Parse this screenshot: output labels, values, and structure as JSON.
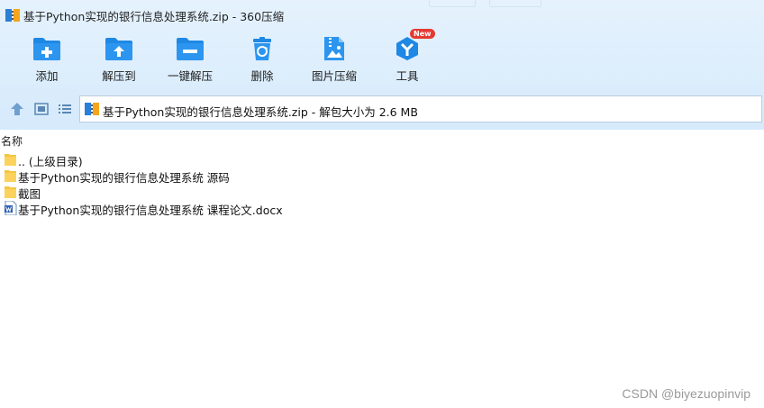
{
  "window": {
    "title": "基于Python实现的银行信息处理系统.zip - 360压缩"
  },
  "toolbar": {
    "items": [
      {
        "label": "添加",
        "icon": "folder-add-icon"
      },
      {
        "label": "解压到",
        "icon": "folder-extract-icon"
      },
      {
        "label": "一键解压",
        "icon": "folder-one-click-extract-icon"
      },
      {
        "label": "删除",
        "icon": "trash-icon"
      },
      {
        "label": "图片压缩",
        "icon": "image-compress-icon"
      },
      {
        "label": "工具",
        "icon": "tools-icon"
      }
    ],
    "new_badge": "New"
  },
  "nav": {
    "address": "基于Python实现的银行信息处理系统.zip - 解包大小为 2.6 MB"
  },
  "list": {
    "column_name": "名称",
    "rows": [
      {
        "label": ".. (上级目录)",
        "icon": "folder-icon"
      },
      {
        "label": "基于Python实现的银行信息处理系统 源码",
        "icon": "folder-icon"
      },
      {
        "label": "截图",
        "icon": "folder-icon"
      },
      {
        "label": "基于Python实现的银行信息处理系统 课程论文.docx",
        "icon": "word-document-icon"
      }
    ]
  },
  "watermark": "CSDN @biyezuopinvip",
  "colors": {
    "accent": "#1e88e5",
    "header_bg": "#d9ecfc",
    "badge": "#e43a33"
  }
}
